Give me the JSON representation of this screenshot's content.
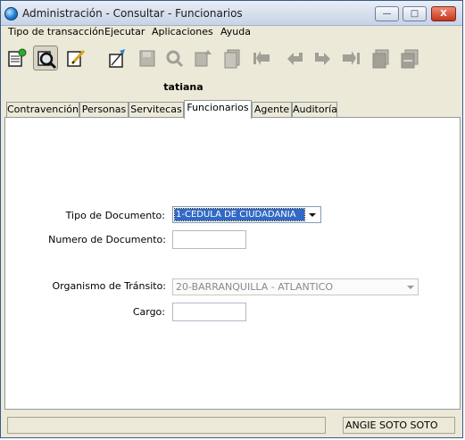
{
  "window": {
    "title": "Administración - Consultar - Funcionarios",
    "minimize_label": "—",
    "maximize_label": "□",
    "close_label": "X"
  },
  "menu": [
    "Tipo de transacción",
    "Ejecutar",
    "Aplicaciones",
    "Ayuda"
  ],
  "toolbar_icons": [
    "new-record-icon",
    "query-icon",
    "edit-icon",
    "clear-icon",
    "save-icon",
    "delete-icon",
    "undo-icon",
    "copy-icon",
    "first-record-icon",
    "previous-record-icon",
    "next-record-icon",
    "last-record-icon",
    "insert-record-icon",
    "remove-record-icon"
  ],
  "user": {
    "name": "tatiana"
  },
  "tabs": [
    "Contravención",
    "Personas",
    "Servitecas",
    "Funcionarios",
    "Agente",
    "Auditoría"
  ],
  "active_tab": "Funcionarios",
  "form": {
    "tipo_documento_label": "Tipo de Documento:",
    "tipo_documento_value": "1-CEDULA DE CIUDADANIA",
    "numero_documento_label": "Numero de Documento:",
    "numero_documento_value": "",
    "organismo_label": "Organismo de Tránsito:",
    "organismo_value": "20-BARRANQUILLA - ATLANTICO",
    "cargo_label": "Cargo:",
    "cargo_value": ""
  },
  "status": {
    "message": "",
    "user_fullname": "ANGIE  SOTO SOTO"
  }
}
